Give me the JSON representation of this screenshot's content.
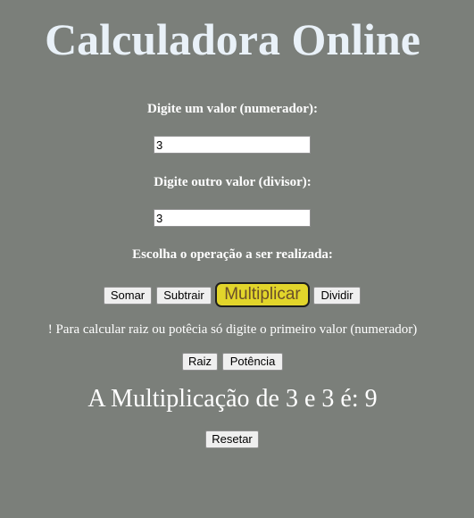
{
  "header": {
    "title": "Calculadora Online"
  },
  "form": {
    "numerator_label": "Digite um valor (numerador):",
    "numerator_value": "3",
    "divisor_label": "Digite outro valor (divisor):",
    "divisor_value": "3",
    "operation_label": "Escolha o operação a ser realizada:"
  },
  "operations": {
    "sum": "Somar",
    "subtract": "Subtrair",
    "multiply": "Multiplicar",
    "divide": "Dividir"
  },
  "note": "! Para calcular raiz ou potêcia só digite o primeiro valor (numerador)",
  "extra_operations": {
    "root": "Raiz",
    "power": "Potência"
  },
  "result": "A Multiplicação de 3 e 3 é: 9",
  "reset_label": "Resetar",
  "colors": {
    "background": "#7b7f7a",
    "title": "#e9f1f8",
    "highlight_button": "#e2d52b"
  }
}
